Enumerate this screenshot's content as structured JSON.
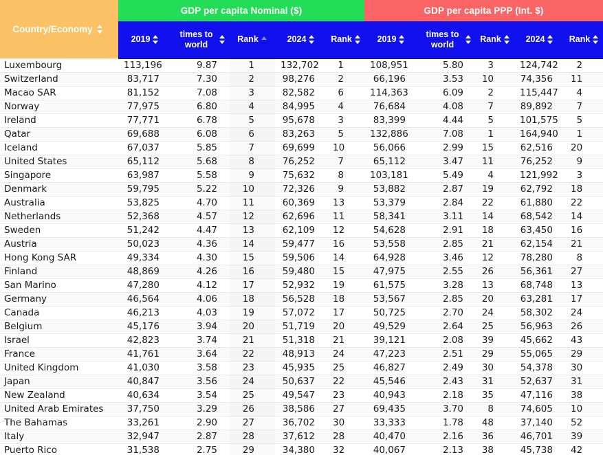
{
  "table": {
    "groups": [
      {
        "label": "",
        "key": "country"
      },
      {
        "label": "GDP per capita Nominal ($)",
        "key": "nominal",
        "color": "#22dd55"
      },
      {
        "label": "GDP per capita PPP (Int. $)",
        "key": "ppp",
        "color": "#fb6465"
      }
    ],
    "country_header": {
      "label": "Country/Economy",
      "sort": "both",
      "bg": "#fbc164"
    },
    "columns": [
      {
        "label": "2019",
        "sort": "both"
      },
      {
        "label": "times to world",
        "sort": "both"
      },
      {
        "label": "Rank",
        "sort": "asc"
      },
      {
        "label": "2024",
        "sort": "both"
      },
      {
        "label": "Rank",
        "sort": "both"
      },
      {
        "label": "2019",
        "sort": "both"
      },
      {
        "label": "times to world",
        "sort": "both"
      },
      {
        "label": "Rank",
        "sort": "both"
      },
      {
        "label": "2024",
        "sort": "both"
      },
      {
        "label": "Rank",
        "sort": "both"
      }
    ],
    "rows": [
      {
        "country": "Luxembourg",
        "n2019": "113,196",
        "ntimes": "9.87",
        "nrank2019": "1",
        "n2024": "132,702",
        "nrank2024": "1",
        "p2019": "108,951",
        "ptimes": "5.80",
        "prank2019": "3",
        "p2024": "124,742",
        "prank2024": "2"
      },
      {
        "country": "Switzerland",
        "n2019": "83,717",
        "ntimes": "7.30",
        "nrank2019": "2",
        "n2024": "98,276",
        "nrank2024": "2",
        "p2019": "66,196",
        "ptimes": "3.53",
        "prank2019": "10",
        "p2024": "74,356",
        "prank2024": "11"
      },
      {
        "country": "Macao SAR",
        "n2019": "81,152",
        "ntimes": "7.08",
        "nrank2019": "3",
        "n2024": "82,582",
        "nrank2024": "6",
        "p2019": "114,363",
        "ptimes": "6.09",
        "prank2019": "2",
        "p2024": "115,447",
        "prank2024": "4"
      },
      {
        "country": "Norway",
        "n2019": "77,975",
        "ntimes": "6.80",
        "nrank2019": "4",
        "n2024": "84,995",
        "nrank2024": "4",
        "p2019": "76,684",
        "ptimes": "4.08",
        "prank2019": "7",
        "p2024": "89,892",
        "prank2024": "7"
      },
      {
        "country": "Ireland",
        "n2019": "77,771",
        "ntimes": "6.78",
        "nrank2019": "5",
        "n2024": "95,678",
        "nrank2024": "3",
        "p2019": "83,399",
        "ptimes": "4.44",
        "prank2019": "5",
        "p2024": "101,575",
        "prank2024": "5"
      },
      {
        "country": "Qatar",
        "n2019": "69,688",
        "ntimes": "6.08",
        "nrank2019": "6",
        "n2024": "83,263",
        "nrank2024": "5",
        "p2019": "132,886",
        "ptimes": "7.08",
        "prank2019": "1",
        "p2024": "164,940",
        "prank2024": "1"
      },
      {
        "country": "Iceland",
        "n2019": "67,037",
        "ntimes": "5.85",
        "nrank2019": "7",
        "n2024": "69,699",
        "nrank2024": "10",
        "p2019": "56,066",
        "ptimes": "2.99",
        "prank2019": "15",
        "p2024": "62,516",
        "prank2024": "20"
      },
      {
        "country": "United States",
        "n2019": "65,112",
        "ntimes": "5.68",
        "nrank2019": "8",
        "n2024": "76,252",
        "nrank2024": "7",
        "p2019": "65,112",
        "ptimes": "3.47",
        "prank2019": "11",
        "p2024": "76,252",
        "prank2024": "9"
      },
      {
        "country": "Singapore",
        "n2019": "63,987",
        "ntimes": "5.58",
        "nrank2019": "9",
        "n2024": "75,632",
        "nrank2024": "8",
        "p2019": "103,181",
        "ptimes": "5.49",
        "prank2019": "4",
        "p2024": "121,992",
        "prank2024": "3"
      },
      {
        "country": "Denmark",
        "n2019": "59,795",
        "ntimes": "5.22",
        "nrank2019": "10",
        "n2024": "72,326",
        "nrank2024": "9",
        "p2019": "53,882",
        "ptimes": "2.87",
        "prank2019": "19",
        "p2024": "62,792",
        "prank2024": "18"
      },
      {
        "country": "Australia",
        "n2019": "53,825",
        "ntimes": "4.70",
        "nrank2019": "11",
        "n2024": "60,369",
        "nrank2024": "13",
        "p2019": "53,379",
        "ptimes": "2.84",
        "prank2019": "22",
        "p2024": "61,880",
        "prank2024": "22"
      },
      {
        "country": "Netherlands",
        "n2019": "52,368",
        "ntimes": "4.57",
        "nrank2019": "12",
        "n2024": "62,696",
        "nrank2024": "11",
        "p2019": "58,341",
        "ptimes": "3.11",
        "prank2019": "14",
        "p2024": "68,542",
        "prank2024": "14"
      },
      {
        "country": "Sweden",
        "n2019": "51,242",
        "ntimes": "4.47",
        "nrank2019": "13",
        "n2024": "62,109",
        "nrank2024": "12",
        "p2019": "54,628",
        "ptimes": "2.91",
        "prank2019": "18",
        "p2024": "63,450",
        "prank2024": "16"
      },
      {
        "country": "Austria",
        "n2019": "50,023",
        "ntimes": "4.36",
        "nrank2019": "14",
        "n2024": "59,477",
        "nrank2024": "16",
        "p2019": "53,558",
        "ptimes": "2.85",
        "prank2019": "21",
        "p2024": "62,154",
        "prank2024": "21"
      },
      {
        "country": "Hong Kong SAR",
        "n2019": "49,334",
        "ntimes": "4.30",
        "nrank2019": "15",
        "n2024": "59,506",
        "nrank2024": "14",
        "p2019": "64,928",
        "ptimes": "3.46",
        "prank2019": "12",
        "p2024": "78,280",
        "prank2024": "8"
      },
      {
        "country": "Finland",
        "n2019": "48,869",
        "ntimes": "4.26",
        "nrank2019": "16",
        "n2024": "59,480",
        "nrank2024": "15",
        "p2019": "47,975",
        "ptimes": "2.55",
        "prank2019": "26",
        "p2024": "56,361",
        "prank2024": "27"
      },
      {
        "country": "San Marino",
        "n2019": "47,280",
        "ntimes": "4.12",
        "nrank2019": "17",
        "n2024": "52,932",
        "nrank2024": "19",
        "p2019": "61,575",
        "ptimes": "3.28",
        "prank2019": "13",
        "p2024": "68,748",
        "prank2024": "13"
      },
      {
        "country": "Germany",
        "n2019": "46,564",
        "ntimes": "4.06",
        "nrank2019": "18",
        "n2024": "56,528",
        "nrank2024": "18",
        "p2019": "53,567",
        "ptimes": "2.85",
        "prank2019": "20",
        "p2024": "63,281",
        "prank2024": "17"
      },
      {
        "country": "Canada",
        "n2019": "46,213",
        "ntimes": "4.03",
        "nrank2019": "19",
        "n2024": "57,072",
        "nrank2024": "17",
        "p2019": "50,725",
        "ptimes": "2.70",
        "prank2019": "24",
        "p2024": "58,302",
        "prank2024": "24"
      },
      {
        "country": "Belgium",
        "n2019": "45,176",
        "ntimes": "3.94",
        "nrank2019": "20",
        "n2024": "51,719",
        "nrank2024": "20",
        "p2019": "49,529",
        "ptimes": "2.64",
        "prank2019": "25",
        "p2024": "56,963",
        "prank2024": "26"
      },
      {
        "country": "Israel",
        "n2019": "42,823",
        "ntimes": "3.74",
        "nrank2019": "21",
        "n2024": "51,318",
        "nrank2024": "21",
        "p2019": "39,121",
        "ptimes": "2.08",
        "prank2019": "39",
        "p2024": "45,662",
        "prank2024": "43"
      },
      {
        "country": "France",
        "n2019": "41,761",
        "ntimes": "3.64",
        "nrank2019": "22",
        "n2024": "48,913",
        "nrank2024": "24",
        "p2019": "47,223",
        "ptimes": "2.51",
        "prank2019": "29",
        "p2024": "55,065",
        "prank2024": "29"
      },
      {
        "country": "United Kingdom",
        "n2019": "41,030",
        "ntimes": "3.58",
        "nrank2019": "23",
        "n2024": "45,935",
        "nrank2024": "25",
        "p2019": "46,827",
        "ptimes": "2.49",
        "prank2019": "30",
        "p2024": "54,378",
        "prank2024": "30"
      },
      {
        "country": "Japan",
        "n2019": "40,847",
        "ntimes": "3.56",
        "nrank2019": "24",
        "n2024": "50,637",
        "nrank2024": "22",
        "p2019": "45,546",
        "ptimes": "2.43",
        "prank2019": "31",
        "p2024": "52,637",
        "prank2024": "31"
      },
      {
        "country": "New Zealand",
        "n2019": "40,634",
        "ntimes": "3.54",
        "nrank2019": "25",
        "n2024": "49,547",
        "nrank2024": "23",
        "p2019": "40,943",
        "ptimes": "2.18",
        "prank2019": "35",
        "p2024": "47,116",
        "prank2024": "38"
      },
      {
        "country": "United Arab Emirates",
        "n2019": "37,750",
        "ntimes": "3.29",
        "nrank2019": "26",
        "n2024": "38,586",
        "nrank2024": "27",
        "p2019": "69,435",
        "ptimes": "3.70",
        "prank2019": "8",
        "p2024": "74,605",
        "prank2024": "10"
      },
      {
        "country": "The Bahamas",
        "n2019": "33,261",
        "ntimes": "2.90",
        "nrank2019": "27",
        "n2024": "36,702",
        "nrank2024": "30",
        "p2019": "33,333",
        "ptimes": "1.78",
        "prank2019": "48",
        "p2024": "37,140",
        "prank2024": "52"
      },
      {
        "country": "Italy",
        "n2019": "32,947",
        "ntimes": "2.87",
        "nrank2019": "28",
        "n2024": "37,612",
        "nrank2024": "28",
        "p2019": "40,470",
        "ptimes": "2.16",
        "prank2019": "36",
        "p2024": "46,701",
        "prank2024": "39"
      },
      {
        "country": "Puerto Rico",
        "n2019": "31,538",
        "ntimes": "2.75",
        "nrank2019": "29",
        "n2024": "34,380",
        "nrank2024": "32",
        "p2019": "40,067",
        "ptimes": "2.13",
        "prank2019": "38",
        "p2024": "45,738",
        "prank2024": "42"
      }
    ]
  }
}
